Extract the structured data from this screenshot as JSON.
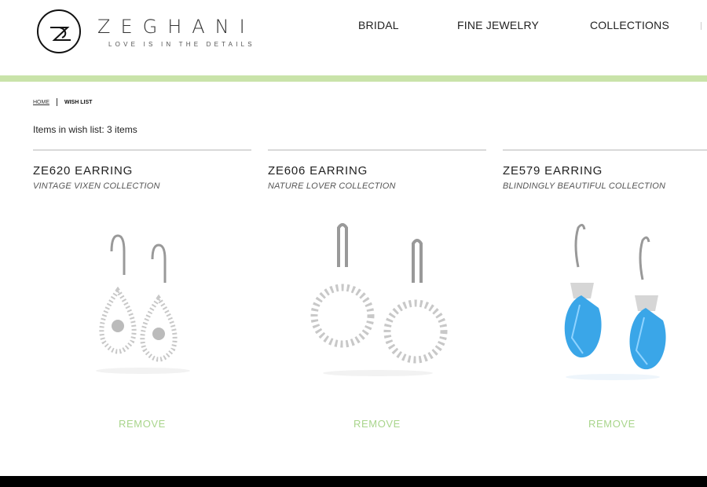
{
  "brand": {
    "name": "ZEGHANI",
    "tagline": "LOVE IS IN THE DETAILS"
  },
  "nav": {
    "items": [
      {
        "label": "BRIDAL"
      },
      {
        "label": "FINE JEWELRY"
      },
      {
        "label": "COLLECTIONS"
      }
    ]
  },
  "breadcrumb": {
    "home": "HOME",
    "current": "WISH LIST"
  },
  "wishlist": {
    "count_text": "Items in wish list: 3 items",
    "items": [
      {
        "title": "ZE620 EARRING",
        "collection": "VINTAGE VIXEN COLLECTION",
        "remove": "REMOVE",
        "image": "diamond-teardrop-earrings"
      },
      {
        "title": "ZE606 EARRING",
        "collection": "NATURE LOVER COLLECTION",
        "remove": "REMOVE",
        "image": "diamond-circle-earrings"
      },
      {
        "title": "ZE579 EARRING",
        "collection": "BLINDINGLY BEAUTIFUL COLLECTION",
        "remove": "REMOVE",
        "image": "blue-topaz-drop-earrings"
      }
    ]
  },
  "colors": {
    "accent_green": "#c9e3a9",
    "remove_text": "#a9d58c",
    "topaz": "#3aa6e8"
  }
}
